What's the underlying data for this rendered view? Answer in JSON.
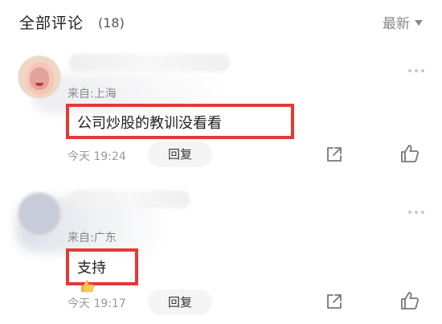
{
  "header": {
    "title": "全部评论",
    "count": "(18)",
    "sort_label": "最新"
  },
  "comments": [
    {
      "location": "来自:上海",
      "content": "公司炒股的教训没看看",
      "time": "今天 19:24",
      "reply_label": "回复",
      "highlight_color": "#e53935"
    },
    {
      "location": "来自:广东",
      "content": "支持",
      "emoji": "thumbs-up-emoji",
      "time": "今天 19:17",
      "reply_label": "回复",
      "highlight_color": "#e53935"
    }
  ],
  "icons": {
    "sort": "caret-down-icon",
    "more": "more-dots-icon",
    "share": "share-icon",
    "like": "thumbs-up-icon"
  },
  "colors": {
    "text_primary": "#1f1f1f",
    "text_secondary": "#888888",
    "reply_bg": "#f5f5f5",
    "icon": "#777777"
  }
}
